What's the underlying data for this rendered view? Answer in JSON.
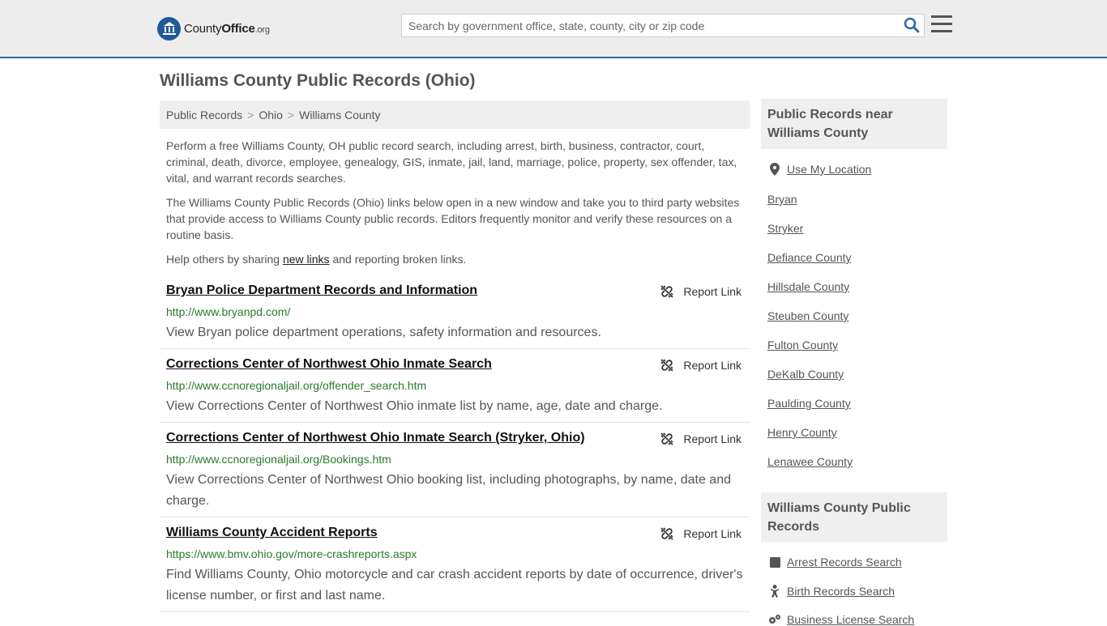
{
  "header": {
    "logo": {
      "name_part1": "County",
      "name_part2": "Office",
      "suffix": ".org"
    },
    "search": {
      "placeholder": "Search by government office, state, county, city or zip code"
    }
  },
  "page": {
    "title": "Williams County Public Records (Ohio)",
    "breadcrumb": [
      "Public Records",
      "Ohio",
      "Williams County"
    ],
    "breadcrumb_sep": ">",
    "intro1": "Perform a free Williams County, OH public record search, including arrest, birth, business, contractor, court, criminal, death, divorce, employee, genealogy, GIS, inmate, jail, land, marriage, police, property, sex offender, tax, vital, and warrant records searches.",
    "intro2": "The Williams County Public Records (Ohio) links below open in a new window and take you to third party websites that provide access to Williams County public records. Editors frequently monitor and verify these resources on a routine basis.",
    "help_prefix": "Help others by sharing ",
    "help_link": "new links",
    "help_suffix": " and reporting broken links."
  },
  "records": [
    {
      "title": "Bryan Police Department Records and Information",
      "url": "http://www.bryanpd.com/",
      "desc": "View Bryan police department operations, safety information and resources.",
      "report": "Report Link"
    },
    {
      "title": "Corrections Center of Northwest Ohio Inmate Search",
      "url": "http://www.ccnoregionaljail.org/offender_search.htm",
      "desc": "View Corrections Center of Northwest Ohio inmate list by name, age, date and charge.",
      "report": "Report Link"
    },
    {
      "title": "Corrections Center of Northwest Ohio Inmate Search (Stryker, Ohio)",
      "url": "http://www.ccnoregionaljail.org/Bookings.htm",
      "desc": "View Corrections Center of Northwest Ohio booking list, including photographs, by name, date and charge.",
      "report": "Report Link"
    },
    {
      "title": "Williams County Accident Reports",
      "url": "https://www.bmv.ohio.gov/more-crashreports.aspx",
      "desc": "Find Williams County, Ohio motorcycle and car crash accident reports by date of occurrence, driver's license number, or first and last name.",
      "report": "Report Link"
    }
  ],
  "sidebar": {
    "near_heading": "Public Records near Williams County",
    "use_location": "Use My Location",
    "near_links": [
      "Bryan",
      "Stryker",
      "Defiance County",
      "Hillsdale County",
      "Steuben County",
      "Fulton County",
      "DeKalb County",
      "Paulding County",
      "Henry County",
      "Lenawee County"
    ],
    "records_heading": "Williams County Public Records",
    "record_links": [
      {
        "label": "Arrest Records Search",
        "icon": "square-icon"
      },
      {
        "label": "Birth Records Search",
        "icon": "baby-icon"
      },
      {
        "label": "Business License Search",
        "icon": "gears-icon"
      }
    ]
  },
  "colors": {
    "accent": "#2e6aa8",
    "url_green": "#2b7a2b",
    "panel_bg": "#efefef",
    "header_bg": "#ededed"
  }
}
